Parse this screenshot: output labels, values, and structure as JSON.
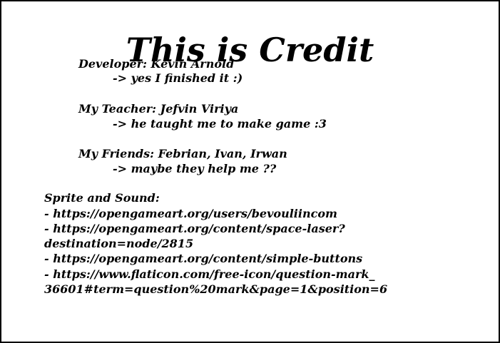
{
  "credits": {
    "title": "This is Credit",
    "developer": {
      "heading": "Developer: Kevin Arnold",
      "note": "-> yes I finished it :)"
    },
    "teacher": {
      "heading": "My Teacher: Jefvin Viriya",
      "note": "-> he taught me to make game :3"
    },
    "friends": {
      "heading": "My Friends: Febrian, Ivan, Irwan",
      "note": "-> maybe they help me ??"
    },
    "sources": {
      "heading": "Sprite and Sound:",
      "lines": [
        "- https://opengameart.org/users/bevouliincom",
        "- https://opengameart.org/content/space-laser?",
        "destination=node/2815",
        "- https://opengameart.org/content/simple-buttons",
        "- https://www.flaticon.com/free-icon/question-mark_",
        "36601#term=question%20mark&page=1&position=6"
      ]
    }
  }
}
